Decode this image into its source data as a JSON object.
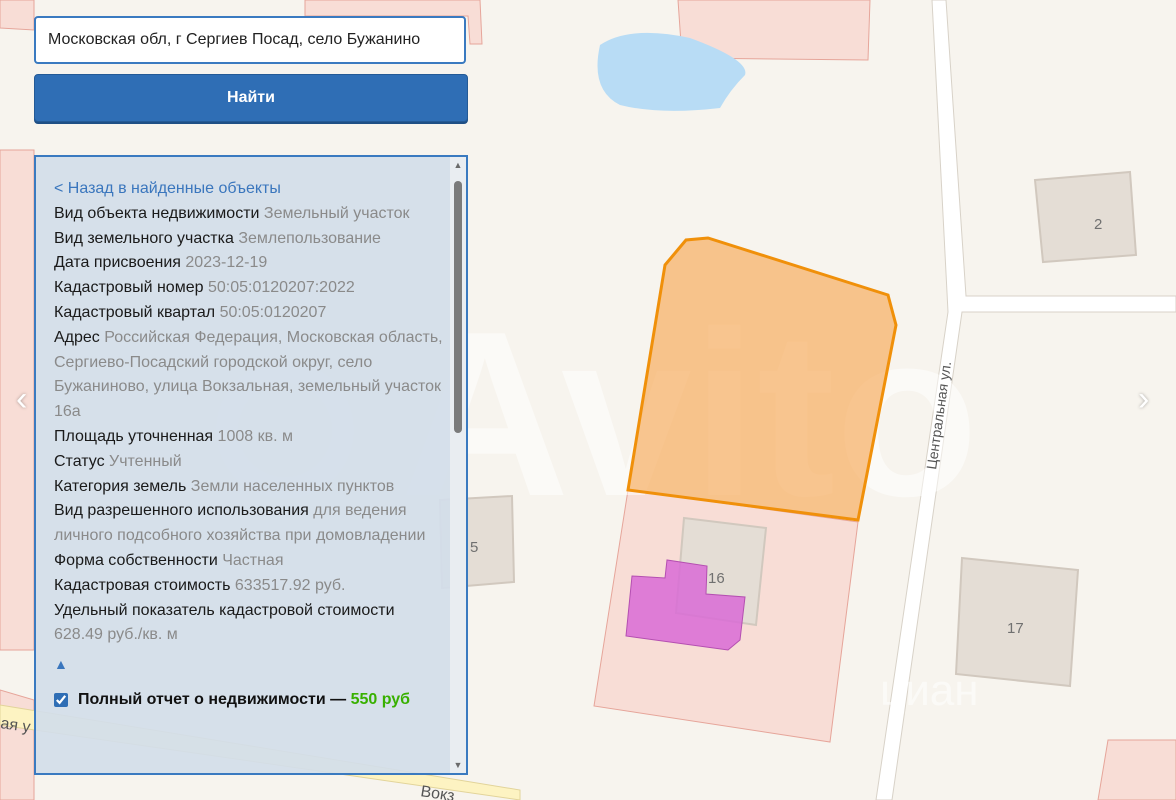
{
  "search": {
    "value": "Московская обл, г Сергиев Посад, село Бужанино",
    "button_label": "Найти"
  },
  "panel": {
    "back_link": "< Назад в найденные объекты",
    "rows": [
      {
        "label": "Вид объекта недвижимости",
        "value": "Земельный участок"
      },
      {
        "label": "Вид земельного участка",
        "value": "Землепользование"
      },
      {
        "label": "Дата присвоения",
        "value": "2023-12-19"
      },
      {
        "label": "Кадастровый номер",
        "value": "50:05:0120207:2022"
      },
      {
        "label": "Кадастровый квартал",
        "value": "50:05:0120207"
      },
      {
        "label": "Адрес",
        "value": "Российская Федерация, Московская область, Сергиево-Посадский городской округ, село Бужаниново, улица Вокзальная, земельный участок 16а"
      },
      {
        "label": "Площадь уточненная",
        "value": "1008 кв. м"
      },
      {
        "label": "Статус",
        "value": "Учтенный"
      },
      {
        "label": "Категория земель",
        "value": "Земли населенных пунктов"
      },
      {
        "label": "Вид разрешенного использования",
        "value": "для ведения личного подсобного хозяйства при домовладении"
      },
      {
        "label": "Форма собственности",
        "value": "Частная"
      },
      {
        "label": "Кадастровая стоимость",
        "value": "633517.92 руб."
      },
      {
        "label": "Удельный показатель кадастровой стоимости",
        "value": "628.49 руб./кв. м"
      }
    ],
    "collapse_icon": "▲",
    "report": {
      "checked": true,
      "label": "Полный отчет о недвижимости — ",
      "price": "550 руб"
    }
  },
  "map": {
    "house_numbers": [
      "2",
      "5",
      "16",
      "17"
    ],
    "streets": [
      "Центральная ул.",
      "Вокз",
      "ая у"
    ],
    "watermark": "Avito",
    "watermark_faint": "циан"
  },
  "nav": {
    "prev": "‹",
    "next": "›"
  },
  "colors": {
    "accent": "#2f6eb5",
    "selected_parcel": "#f6a24a",
    "building_highlight": "#d96bd6",
    "price": "#38b000"
  }
}
